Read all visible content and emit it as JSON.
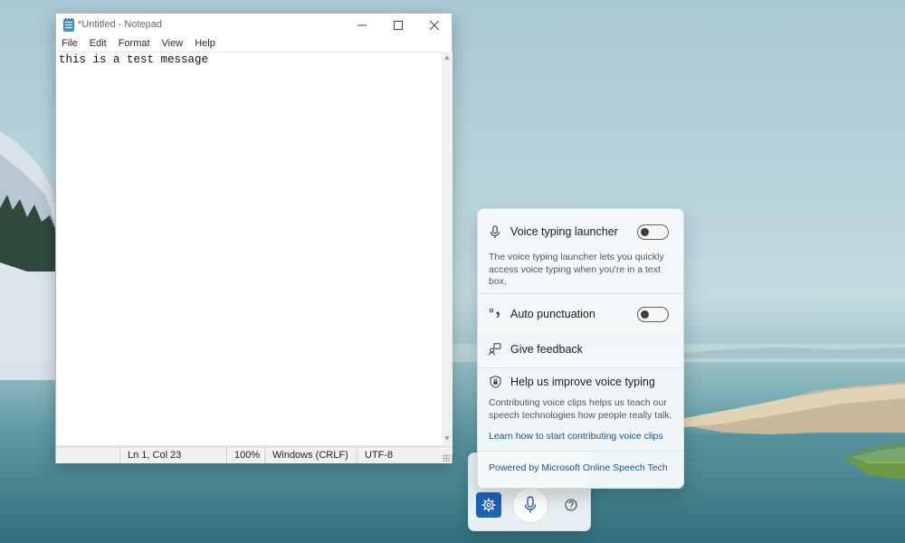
{
  "notepad": {
    "title": "*Untitled - Notepad",
    "menu": [
      "File",
      "Edit",
      "Format",
      "View",
      "Help"
    ],
    "content": "this is a test message",
    "status": {
      "position": "Ln 1, Col 23",
      "zoom": "100%",
      "line_endings": "Windows (CRLF)",
      "encoding": "UTF-8"
    }
  },
  "voice_typing": {
    "launcher_label": "Voice typing launcher",
    "launcher_on": false,
    "launcher_desc": "The voice typing launcher lets you quickly access voice typing when you're in a text box.",
    "punctuation_label": "Auto punctuation",
    "punctuation_on": false,
    "feedback_label": "Give feedback",
    "improve_label": "Help us improve voice typing",
    "improve_desc": "Contributing voice clips helps us teach our speech technologies how people really talk.",
    "learn_link": "Learn how to start contributing voice clips",
    "powered_link": "Powered by Microsoft Online Speech Tech"
  },
  "colors": {
    "accent": "#1d63b8",
    "link": "#1a4e99"
  }
}
